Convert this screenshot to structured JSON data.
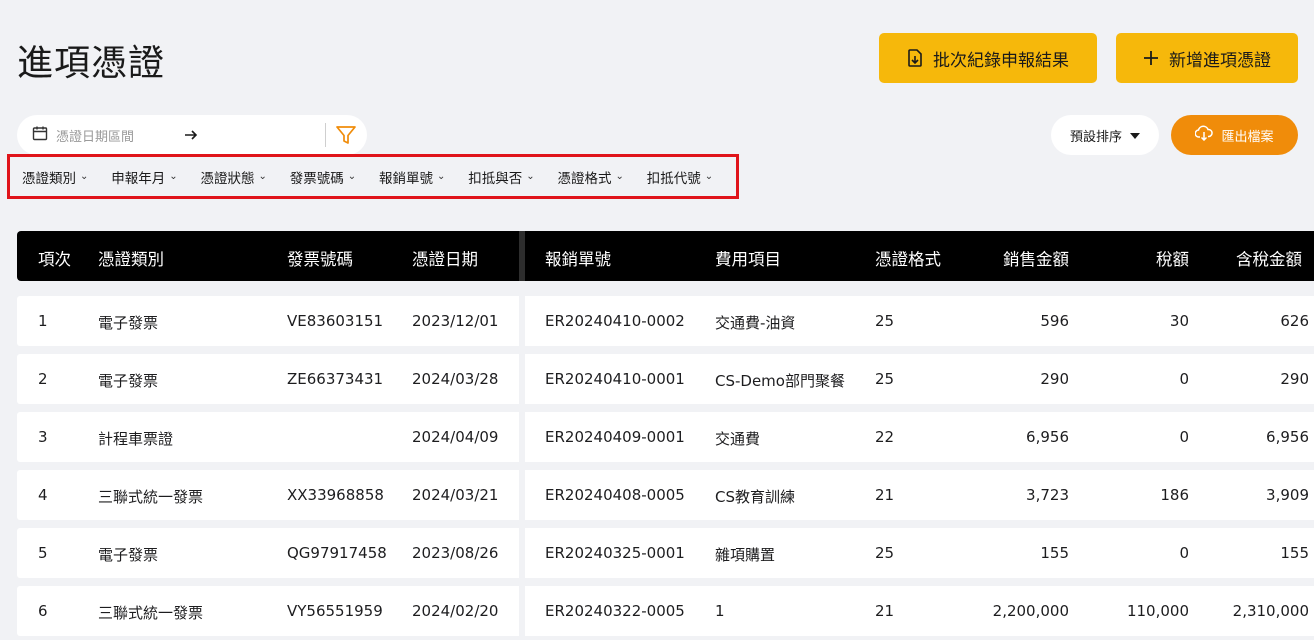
{
  "page": {
    "title": "進項憑證"
  },
  "toolbar": {
    "batch_label": "批次紀錄申報結果",
    "add_label": "新增進項憑證",
    "date_placeholder": "憑證日期區間",
    "sort_label": "預設排序",
    "export_label": "匯出檔案"
  },
  "filters": [
    "憑證類別",
    "申報年月",
    "憑證狀態",
    "發票號碼",
    "報銷單號",
    "扣抵與否",
    "憑證格式",
    "扣抵代號"
  ],
  "table": {
    "headers": [
      "項次",
      "憑證類別",
      "發票號碼",
      "憑證日期",
      "報銷單號",
      "費用項目",
      "憑證格式",
      "銷售金額",
      "稅額",
      "含稅金額"
    ],
    "rows": [
      [
        "1",
        "電子發票",
        "VE83603151",
        "2023/12/01",
        "ER20240410-0002",
        "交通費-油資",
        "25",
        "596",
        "30",
        "626"
      ],
      [
        "2",
        "電子發票",
        "ZE66373431",
        "2024/03/28",
        "ER20240410-0001",
        "CS-Demo部門聚餐",
        "25",
        "290",
        "0",
        "290"
      ],
      [
        "3",
        "計程車票證",
        "",
        "2024/04/09",
        "ER20240409-0001",
        "交通費",
        "22",
        "6,956",
        "0",
        "6,956"
      ],
      [
        "4",
        "三聯式統一發票",
        "XX33968858",
        "2024/03/21",
        "ER20240408-0005",
        "CS教育訓練",
        "21",
        "3,723",
        "186",
        "3,909"
      ],
      [
        "5",
        "電子發票",
        "QG97917458",
        "2023/08/26",
        "ER20240325-0001",
        "雜項購置",
        "25",
        "155",
        "0",
        "155"
      ],
      [
        "6",
        "三聯式統一發票",
        "VY56551959",
        "2024/02/20",
        "ER20240322-0005",
        "1",
        "21",
        "2,200,000",
        "110,000",
        "2,310,000"
      ]
    ]
  },
  "colors": {
    "accent": "#f6b80b",
    "export": "#f08c0a",
    "highlight": "#e0141a"
  },
  "icons": [
    "document-report-icon",
    "plus-icon",
    "calendar-icon",
    "arrow-right-icon",
    "filter-icon",
    "caret-down-icon",
    "cloud-download-icon",
    "chevron-down-icon"
  ]
}
